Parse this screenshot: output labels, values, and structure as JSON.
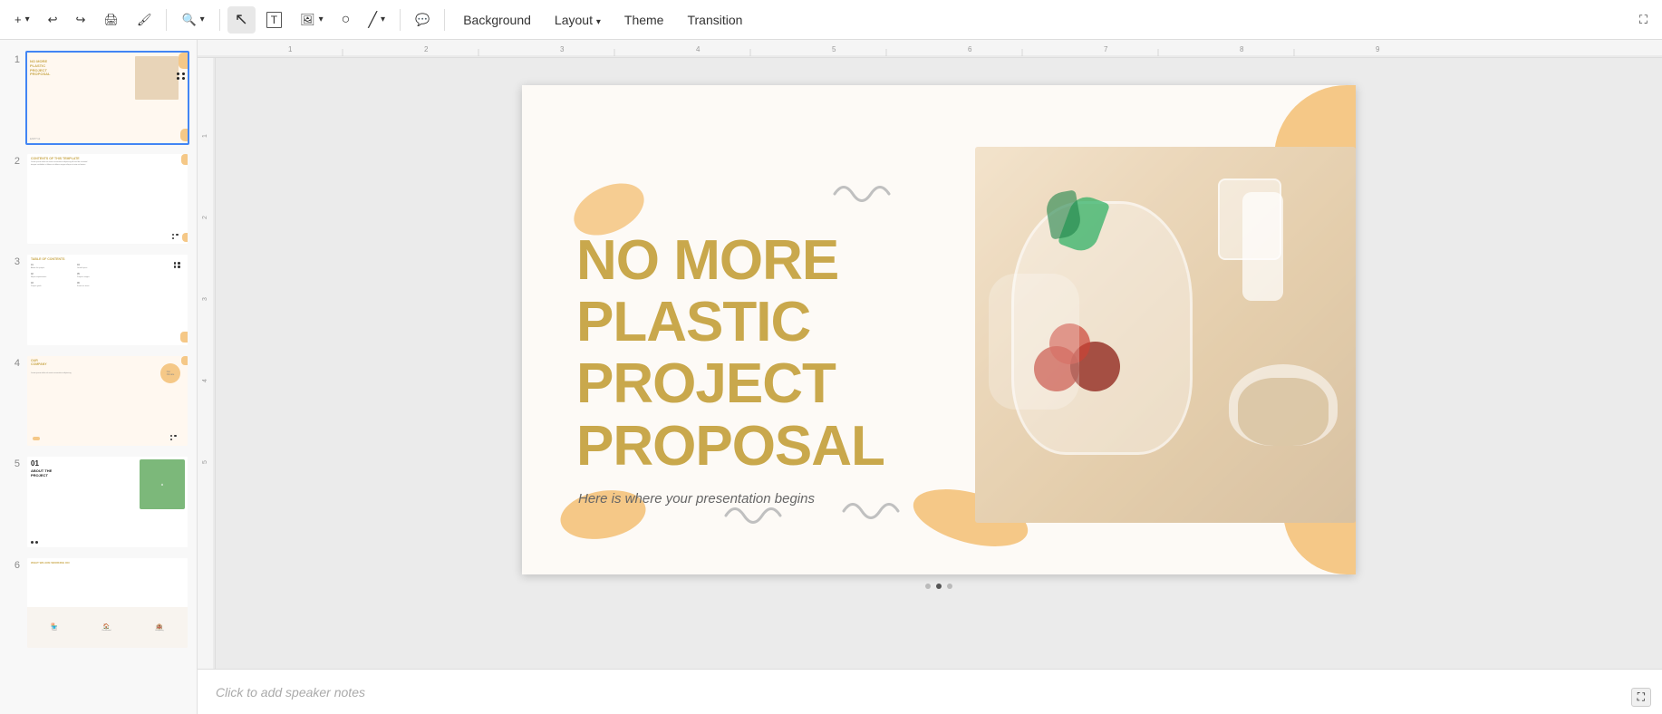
{
  "toolbar": {
    "add_label": "+",
    "undo_label": "↩",
    "redo_label": "↪",
    "print_label": "🖨",
    "paint_label": "🎨",
    "zoom_label": "🔍",
    "cursor_label": "↖",
    "text_label": "T",
    "image_label": "🖼",
    "shape_label": "○",
    "line_label": "╱",
    "comment_label": "💬",
    "background_label": "Background",
    "layout_label": "Layout",
    "theme_label": "Theme",
    "transition_label": "Transition",
    "fullscreen_label": "⛶"
  },
  "slides": [
    {
      "number": "1",
      "selected": true
    },
    {
      "number": "2",
      "selected": false
    },
    {
      "number": "3",
      "selected": false
    },
    {
      "number": "4",
      "selected": false
    },
    {
      "number": "5",
      "selected": false
    },
    {
      "number": "6",
      "selected": false
    }
  ],
  "slide_main": {
    "title_line1": "NO MORE",
    "title_line2": "PLASTIC",
    "title_line3": "PROJECT",
    "title_line4": "PROPOSAL",
    "subtitle": "Here is where your presentation begins"
  },
  "speaker_notes": {
    "placeholder": "Click to add speaker notes"
  },
  "dots": [
    "•",
    "•",
    "•"
  ],
  "slide_thumbnails": [
    {
      "title": "NO MORE\nPLASTIC\nPROJECT\nPROPOSAL",
      "type": "cover"
    },
    {
      "title": "CONTENTS OF THIS TEMPLATE",
      "type": "contents"
    },
    {
      "title": "TABLE OF CONTENTS",
      "type": "toc"
    },
    {
      "title": "OUR COMPANY",
      "type": "company"
    },
    {
      "title": "01\nABOUT THE\nPROJECT",
      "type": "section"
    },
    {
      "title": "WHAT WE ARE WORKING ON",
      "type": "working"
    }
  ]
}
